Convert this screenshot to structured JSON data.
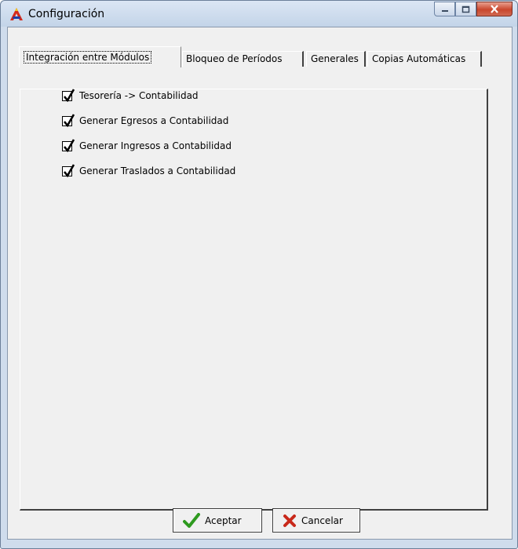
{
  "window": {
    "title": "Configuración",
    "app_icon": "app-logo-icon",
    "controls": [
      "minimize-icon",
      "maximize-icon",
      "close-icon"
    ]
  },
  "tabs": [
    {
      "label": "Integración entre Módulos",
      "active": true
    },
    {
      "label": "Bloqueo de Períodos",
      "active": false
    },
    {
      "label": "Generales",
      "active": false
    },
    {
      "label": "Copias Automáticas",
      "active": false
    }
  ],
  "options": [
    {
      "label": "Tesorería -> Contabilidad",
      "checked": true
    },
    {
      "label": "Generar Egresos a Contabilidad",
      "checked": true
    },
    {
      "label": "Generar Ingresos a Contabilidad",
      "checked": true
    },
    {
      "label": "Generar Traslados a Contabilidad",
      "checked": true
    }
  ],
  "buttons": {
    "accept": {
      "label": "Aceptar",
      "icon": "checkmark-icon",
      "color": "#2e9a1f"
    },
    "cancel": {
      "label": "Cancelar",
      "icon": "x-mark-icon",
      "color": "#c8281a"
    }
  }
}
